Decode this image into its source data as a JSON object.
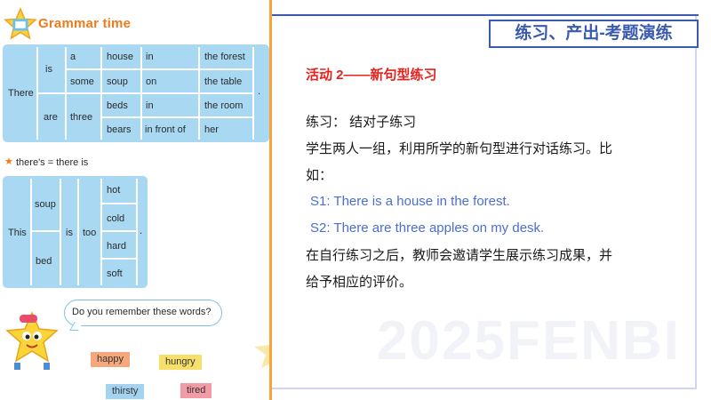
{
  "textbook": {
    "title": "Grammar time",
    "table1": {
      "there": "There",
      "is": "is",
      "are": "are",
      "determiners": [
        "a",
        "some",
        "three"
      ],
      "nouns": [
        "house",
        "soup",
        "beds",
        "bears"
      ],
      "prepositions": [
        "in",
        "on",
        "in",
        "in front of"
      ],
      "places": [
        "the forest",
        "the table",
        "the room",
        "her"
      ],
      "period": "."
    },
    "note_star": "★",
    "note": "there's = there is",
    "table2": {
      "this": "This",
      "subjects": [
        "soup",
        "bed"
      ],
      "is": "is",
      "too": "too",
      "adjectives": [
        "hot",
        "cold",
        "hard",
        "soft"
      ],
      "period": "."
    },
    "bubble": "Do you remember these words?",
    "words": [
      "happy",
      "hungry",
      "thirsty",
      "tired"
    ]
  },
  "slide": {
    "badge": "练习、产出-考题演练",
    "activity_title": "活动 2——新句型练习",
    "practice_line": "练习： 结对子练习",
    "instruction_1": "学生两人一组，利用所学的新句型进行对话练习。比",
    "instruction_2": "如：",
    "s1": "S1: There is a house in the forest.",
    "s2": "S2: There are three apples on my desk.",
    "closing_1": "在自行练习之后，教师会邀请学生展示练习成果，并",
    "closing_2": "给予相应的评价。",
    "watermark": "2025FENBI"
  },
  "colors": {
    "accent_blue": "#3b5bb0",
    "title_red": "#e8201c",
    "example_blue": "#4a6fd0",
    "table_blue": "#a9d8f2",
    "brand_orange": "#f07a1a"
  }
}
